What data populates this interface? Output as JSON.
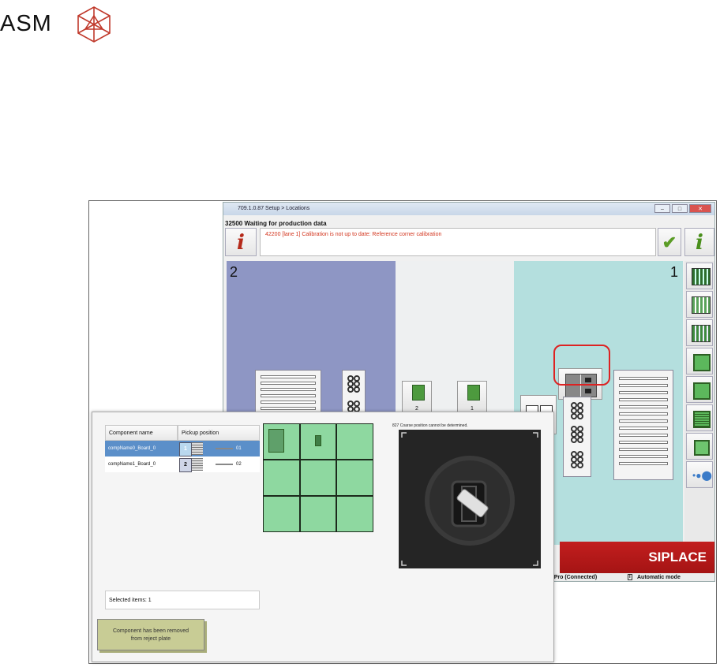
{
  "logo": {
    "text": "ASM"
  },
  "window": {
    "title": "709.1.0.87 Setup > Locations",
    "status": "32500 Waiting for production data",
    "message": "42200 [lane 1] Calibration is not up to date: Reference corner calibration"
  },
  "zones": {
    "left_number": "2",
    "right_number": "1",
    "slot_labels": [
      "2",
      "1"
    ]
  },
  "brand": {
    "siplace": "SIPLACE"
  },
  "bottom_status": {
    "connection": "ACE Pro (Connected)",
    "mode_icon": "I",
    "mode": "Automatic mode"
  },
  "dialog": {
    "columns": [
      "Component name",
      "Pickup position"
    ],
    "rows": [
      {
        "name": "compName0_Board_0",
        "box": "1",
        "pos": "01",
        "selected": true
      },
      {
        "name": "compName1_Board_0",
        "box": "2",
        "pos": "02",
        "selected": false
      }
    ],
    "selected_items": "Selected items: 1",
    "notification_line1": "Component has been removed",
    "notification_line2": "from reject plate",
    "camera_message": "827 Coarse position cannot be determined."
  },
  "colors": {
    "zone_left": "#8e96c4",
    "zone_right": "#b4dfde",
    "alert_text": "#d3361f",
    "brand_red": "#c21e1e",
    "grid_green": "#8ed8a0"
  },
  "icons": [
    "asm-logo-icon",
    "info-icon",
    "checkmark-icon",
    "feeder-icon",
    "nozzle-icon",
    "board-icon",
    "camera-icon"
  ]
}
